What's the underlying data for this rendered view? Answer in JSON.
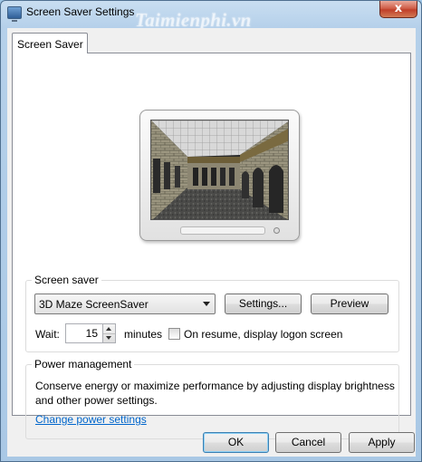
{
  "window": {
    "title": "Screen Saver Settings",
    "close_label": "x",
    "watermark": "Taimienphi.vn"
  },
  "tabs": [
    {
      "label": "Screen Saver",
      "selected": true
    }
  ],
  "preview": {
    "description_icon": "monitor-preview"
  },
  "screen_saver_group": {
    "legend": "Screen saver",
    "selected_saver": "3D Maze ScreenSaver",
    "settings_label": "Settings...",
    "preview_label": "Preview",
    "wait_label": "Wait:",
    "wait_value": "15",
    "minutes_label": "minutes",
    "resume_checkbox_label": "On resume, display logon screen",
    "resume_checked": false
  },
  "power_group": {
    "legend": "Power management",
    "description": "Conserve energy or maximize performance by adjusting display brightness and other power settings.",
    "link_label": "Change power settings"
  },
  "footer": {
    "ok_label": "OK",
    "cancel_label": "Cancel",
    "apply_label": "Apply"
  },
  "colors": {
    "accent_link": "#0066cc",
    "title_gradient": "#b5d0ea",
    "close_button": "#c0402a"
  }
}
